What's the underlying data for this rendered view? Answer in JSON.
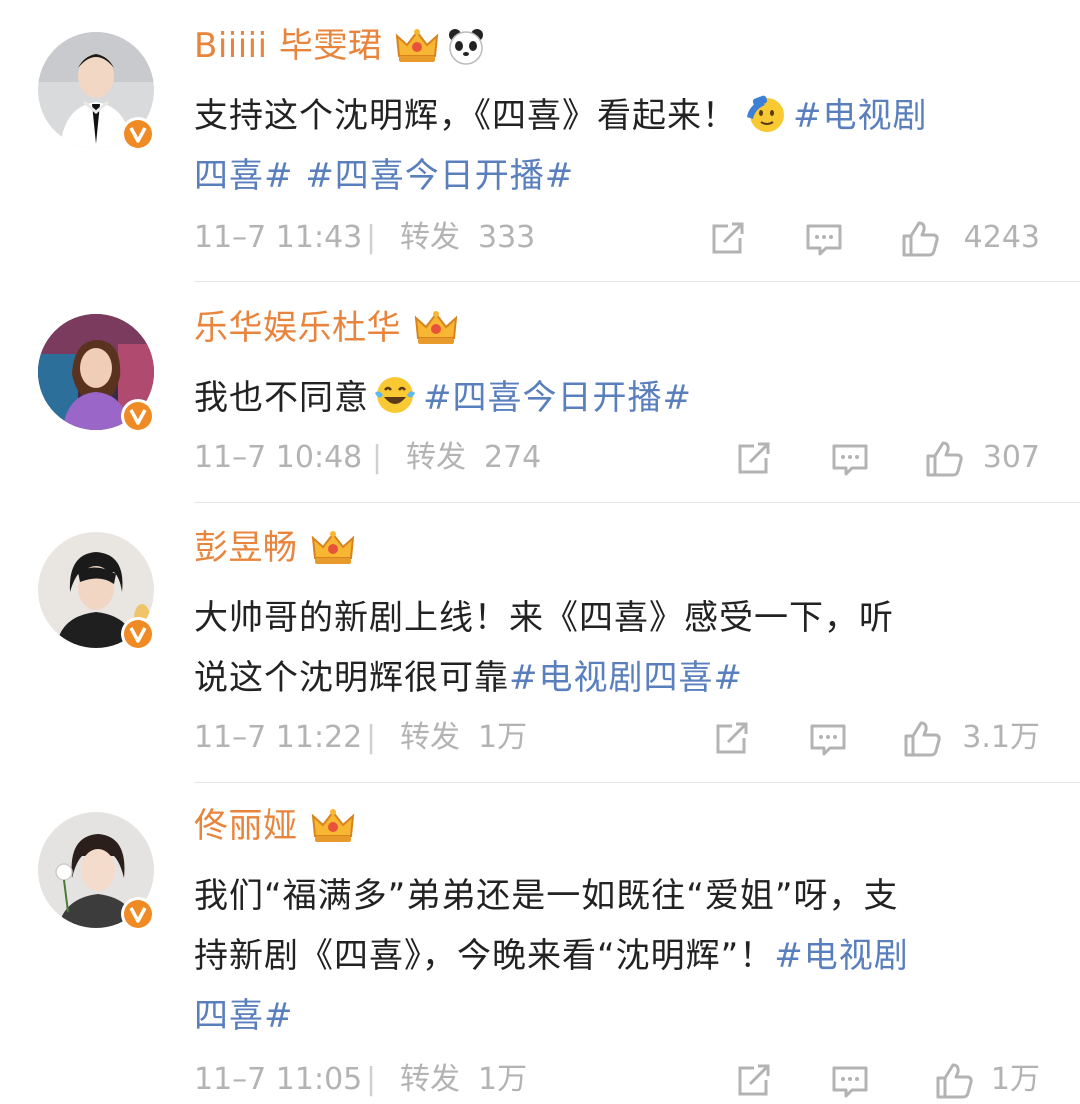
{
  "comments": [
    {
      "name": "Biiiii 毕雯珺",
      "text_before": "支持这个沈明辉，《四喜》看起来！",
      "text_topics": "#电视剧四喜# #四喜今日开播#",
      "topic1": "#电视剧",
      "topic1b": "四喜#",
      "topic2": "#四喜今日开播#",
      "date": "11–7 11:43",
      "repost_label": "转发",
      "repost_count": "333",
      "like_count": "4243",
      "badge_icon": "crown-icon",
      "extra_icon": "panda-icon",
      "emoji": "saluting-face"
    },
    {
      "name": "乐华娱乐杜华",
      "text_before": "我也不同意",
      "topic1": "#四喜今日开播#",
      "date": "11–7 10:48",
      "repost_label": "转发",
      "repost_count": "274",
      "like_count": "307",
      "badge_icon": "crown-icon",
      "emoji": "tears-of-joy"
    },
    {
      "name": "彭昱畅",
      "text_line1": "大帅哥的新剧上线！来《四喜》感受一下，听",
      "text_line2_before": "说这个沈明辉很可靠",
      "topic1": "#电视剧四喜#",
      "date": "11–7 11:22",
      "repost_label": "转发",
      "repost_count": "1万",
      "like_count": "3.1万",
      "badge_icon": "crown-icon"
    },
    {
      "name": "佟丽娅",
      "text_line1": "我们“福满多”弟弟还是一如既往“爱姐”呀，支",
      "text_line2_before": "持新剧《四喜》，今晚来看“沈明辉”！",
      "topic1a": "#电视剧",
      "topic1b": "四喜#",
      "date": "11–7 11:05",
      "repost_label": "转发",
      "repost_count": "1万",
      "like_count": "1万",
      "badge_icon": "crown-icon"
    }
  ],
  "colors": {
    "name": "#e8843c",
    "topic": "#5a7fbd",
    "text": "#222222",
    "meta": "#b3b3b3",
    "verified_badge": "#f08a24"
  }
}
